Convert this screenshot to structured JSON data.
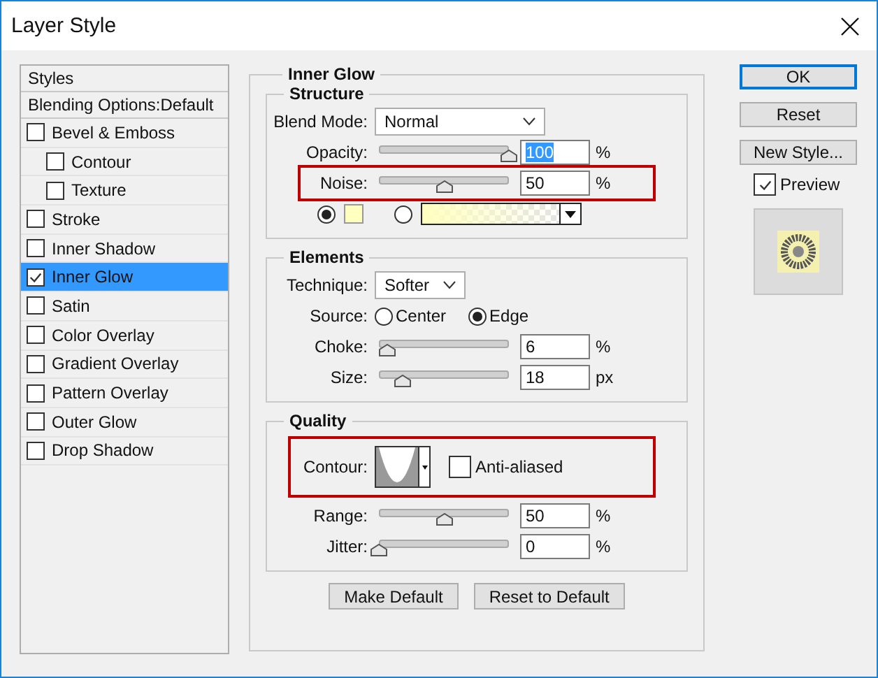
{
  "window": {
    "title": "Layer Style"
  },
  "styles": {
    "header": "Styles",
    "blending": "Blending Options:Default",
    "items": [
      {
        "label": "Bevel & Emboss",
        "checked": false,
        "selected": false,
        "children": [
          {
            "label": "Contour",
            "checked": false,
            "selected": false
          },
          {
            "label": "Texture",
            "checked": false,
            "selected": false
          }
        ]
      },
      {
        "label": "Stroke",
        "checked": false,
        "selected": false
      },
      {
        "label": "Inner Shadow",
        "checked": false,
        "selected": false
      },
      {
        "label": "Inner Glow",
        "checked": true,
        "selected": true
      },
      {
        "label": "Satin",
        "checked": false,
        "selected": false
      },
      {
        "label": "Color Overlay",
        "checked": false,
        "selected": false
      },
      {
        "label": "Gradient Overlay",
        "checked": false,
        "selected": false
      },
      {
        "label": "Pattern Overlay",
        "checked": false,
        "selected": false
      },
      {
        "label": "Outer Glow",
        "checked": false,
        "selected": false
      },
      {
        "label": "Drop Shadow",
        "checked": false,
        "selected": false
      }
    ]
  },
  "inner_glow": {
    "title": "Inner Glow",
    "structure": {
      "title": "Structure",
      "blend_mode": {
        "label": "Blend Mode:",
        "value": "Normal"
      },
      "sliders": [
        {
          "label": "Opacity:",
          "value": "100",
          "value_selected": true,
          "unit": "%",
          "level": 1.0,
          "highlighted": false
        },
        {
          "label": "Noise:",
          "value": "50",
          "value_selected": false,
          "unit": "%",
          "level": 0.5,
          "highlighted": true
        }
      ],
      "fill": [
        {
          "kind": "color",
          "selected": true,
          "color": "#ffffc0"
        },
        {
          "kind": "gradient",
          "selected": false,
          "color": "#ffffc0"
        }
      ]
    },
    "elements": {
      "title": "Elements",
      "technique": {
        "label": "Technique:",
        "value": "Softer"
      },
      "source": {
        "label": "Source:",
        "options": [
          {
            "label": "Center",
            "selected": false
          },
          {
            "label": "Edge",
            "selected": true
          }
        ]
      },
      "sliders": [
        {
          "label": "Choke:",
          "value": "6",
          "value_selected": false,
          "unit": "%",
          "level": 0.06,
          "highlighted": false
        },
        {
          "label": "Size:",
          "value": "18",
          "value_selected": false,
          "unit": "px",
          "level": 0.18,
          "highlighted": false
        }
      ]
    },
    "quality": {
      "title": "Quality",
      "contour": {
        "label": "Contour:",
        "highlighted": true
      },
      "anti_aliased": {
        "label": "Anti-aliased",
        "checked": false
      },
      "sliders": [
        {
          "label": "Range:",
          "value": "50",
          "value_selected": false,
          "unit": "%",
          "level": 0.5,
          "highlighted": false
        },
        {
          "label": "Jitter:",
          "value": "0",
          "value_selected": false,
          "unit": "%",
          "level": 0.0,
          "highlighted": false
        }
      ]
    },
    "buttons": [
      "Make Default",
      "Reset to Default"
    ]
  },
  "actions": [
    {
      "label": "OK",
      "primary": true
    },
    {
      "label": "Reset",
      "primary": false
    },
    {
      "label": "New Style...",
      "primary": false
    }
  ],
  "preview": {
    "label": "Preview",
    "checked": true
  }
}
